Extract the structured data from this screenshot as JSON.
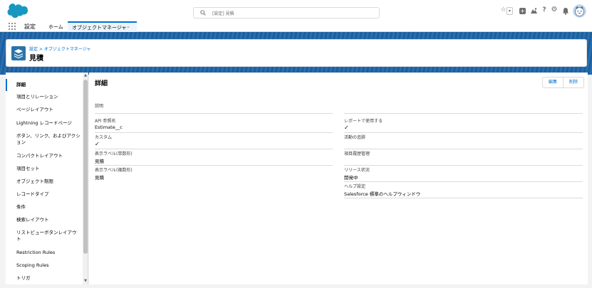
{
  "global_header": {
    "search_placeholder": "[設定] 見積",
    "favorites_star": "☆",
    "favorites_dropdown": "▾",
    "add_icon": "+",
    "help_icon": "?",
    "setup_icon": "⚙",
    "notifications_icon": "🔔",
    "brand_color": "#1798c1"
  },
  "nav": {
    "app_name": "設定",
    "home_tab": "ホーム",
    "object_manager_tab": "オブジェクトマネージャ",
    "tab_chevron": "⌄"
  },
  "record_header": {
    "breadcrumb": "設定 > オブジェクトマネージャ",
    "title": "見積"
  },
  "sidebar": {
    "items": [
      {
        "label": "詳細",
        "active": true
      },
      {
        "label": "項目とリレーション",
        "active": false
      },
      {
        "label": "ページレイアウト",
        "active": false
      },
      {
        "label": "Lightning レコードページ",
        "active": false
      },
      {
        "label": "ボタン、リンク、およびアクション",
        "active": false
      },
      {
        "label": "コンパクトレイアウト",
        "active": false
      },
      {
        "label": "項目セット",
        "active": false
      },
      {
        "label": "オブジェクト制限",
        "active": false
      },
      {
        "label": "レコードタイプ",
        "active": false
      },
      {
        "label": "条件",
        "active": false
      },
      {
        "label": "検索レイアウト",
        "active": false
      },
      {
        "label": "リストビューボタンレイアウト",
        "active": false
      },
      {
        "label": "Restriction Rules",
        "active": false
      },
      {
        "label": "Scoping Rules",
        "active": false
      },
      {
        "label": "トリガ",
        "active": false
      }
    ],
    "scroll_up": "▲",
    "scroll_down": "▼"
  },
  "detail": {
    "title": "詳細",
    "edit_button": "編集",
    "delete_button": "削除",
    "description_label": "説明",
    "left_fields": [
      {
        "label": "API 参照名",
        "value": "Estimate__c"
      },
      {
        "label": "カスタム",
        "value": "✓"
      },
      {
        "label": "表示ラベル(単数形)",
        "value": "見積"
      },
      {
        "label": "表示ラベル(複数形)",
        "value": "見積"
      }
    ],
    "right_fields": [
      {
        "label": "レポートで使用する",
        "value": "✓"
      },
      {
        "label": "活動の追跡",
        "value": ""
      },
      {
        "label": "項目履歴管理",
        "value": ""
      },
      {
        "label": "リリース状況",
        "value": "開発中"
      },
      {
        "label": "ヘルプ設定",
        "value": "Salesforce 標準のヘルプウィンドウ"
      }
    ]
  }
}
